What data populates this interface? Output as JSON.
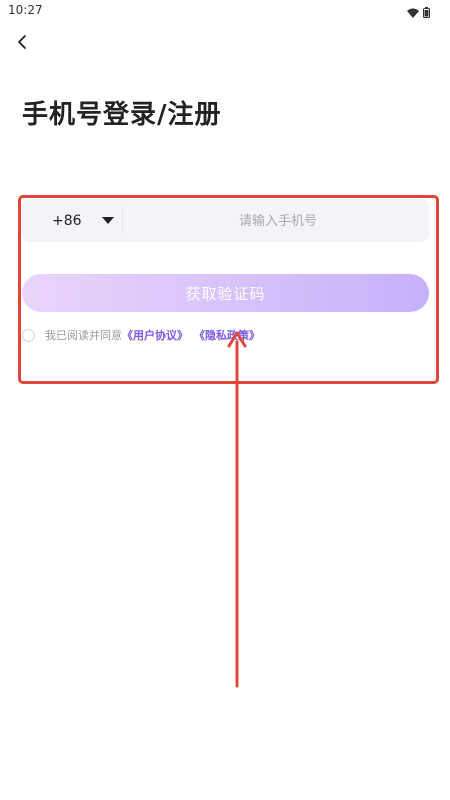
{
  "status_bar": {
    "time": "10:27",
    "icons": [
      "wifi-icon",
      "battery-icon"
    ]
  },
  "nav": {
    "back_icon": "chevron-left-icon"
  },
  "page": {
    "title": "手机号登录/注册"
  },
  "phone_form": {
    "country_code": "+86",
    "country_dropdown_icon": "caret-down-icon",
    "phone_value": "",
    "phone_placeholder": "请输入手机号"
  },
  "get_code_button": {
    "label": "获取验证码"
  },
  "agreement": {
    "prefix": "我已阅读并同意",
    "user_agreement": "《用户协议》",
    "privacy_policy": "《隐私政策》"
  },
  "colors": {
    "accent": "#7f57e6",
    "button_gradient_start": "#ead4fb",
    "button_gradient_end": "#c6b1fa",
    "annotation": "#e2463a"
  }
}
